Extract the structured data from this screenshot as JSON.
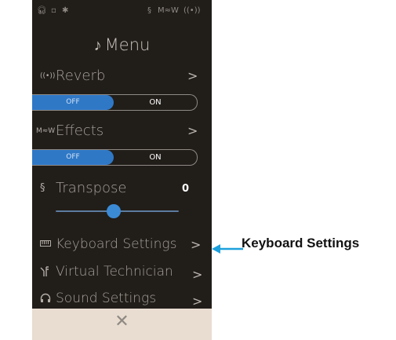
{
  "statusbar": {
    "headphones_icon": "headphones-icon",
    "usb_icon": "usb-icon",
    "bluetooth_icon": "bluetooth-icon",
    "transpose_icon": "transpose-icon",
    "effects_icon": "effects-icon",
    "reverb_icon": "reverb-icon"
  },
  "menu": {
    "title": "Menu",
    "note_icon": "♪"
  },
  "reverb": {
    "label": "Reverb",
    "chevron": ">",
    "icon": "((•))"
  },
  "reverb_toggle": {
    "off_label": "OFF",
    "on_label": "ON",
    "state": "OFF"
  },
  "effects": {
    "label": "Effects",
    "chevron": ">",
    "icon": "M≈W"
  },
  "effects_toggle": {
    "off_label": "OFF",
    "on_label": "ON",
    "state": "OFF"
  },
  "transpose": {
    "label": "Transpose",
    "value": "0",
    "icon": "§",
    "slider_position": 0.5
  },
  "keyboard_settings": {
    "label": "Keyboard Settings",
    "chevron": ">",
    "icon": "keyboard-icon"
  },
  "virtual_technician": {
    "label": "Virtual Technician",
    "chevron": ">",
    "icon": "technician-icon"
  },
  "sound_settings": {
    "label": "Sound Settings",
    "chevron": ">",
    "icon": "headphones-icon"
  },
  "bottom": {
    "close": "✕"
  },
  "callout": {
    "text": "Keyboard Settings",
    "arrow_color": "#1ea0dc"
  },
  "colors": {
    "accent": "#2f78c6",
    "background": "#211d19",
    "bottom_bar": "#e8ddd0"
  }
}
